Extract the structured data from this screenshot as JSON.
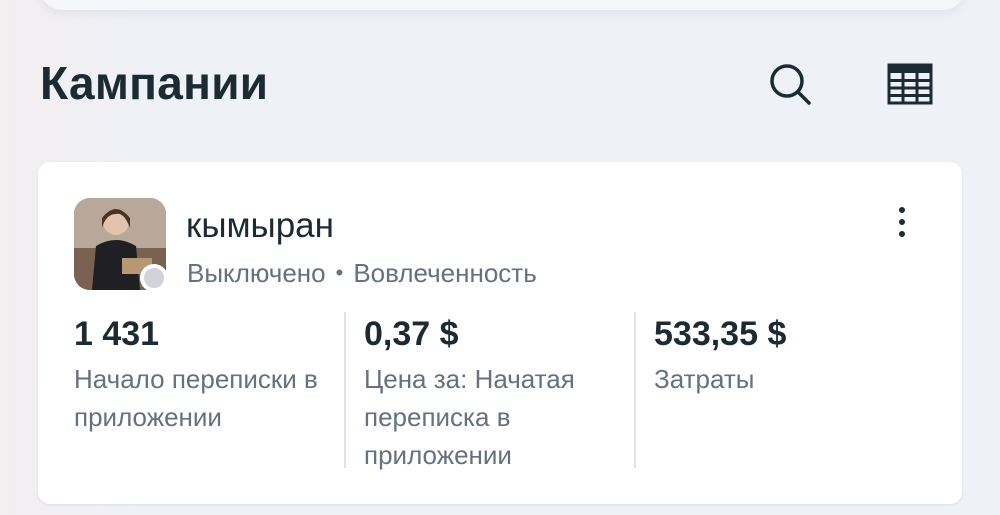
{
  "header": {
    "title": "Кампании",
    "search_icon": "search-icon",
    "table_icon": "table-grid-icon"
  },
  "campaign": {
    "name": "кымыран",
    "status": "Выключено",
    "objective": "Вовлеченность",
    "status_dot_color": "#d0d4da",
    "metrics": [
      {
        "value": "1 431",
        "label": "Начало переписки в приложении"
      },
      {
        "value": "0,37 $",
        "label": "Цена за: Начатая переписка в приложении"
      },
      {
        "value": "533,35 $",
        "label": "Затраты"
      }
    ]
  },
  "colors": {
    "text_primary": "#1c2b33",
    "text_secondary": "#65717d",
    "card_bg": "#ffffff"
  }
}
